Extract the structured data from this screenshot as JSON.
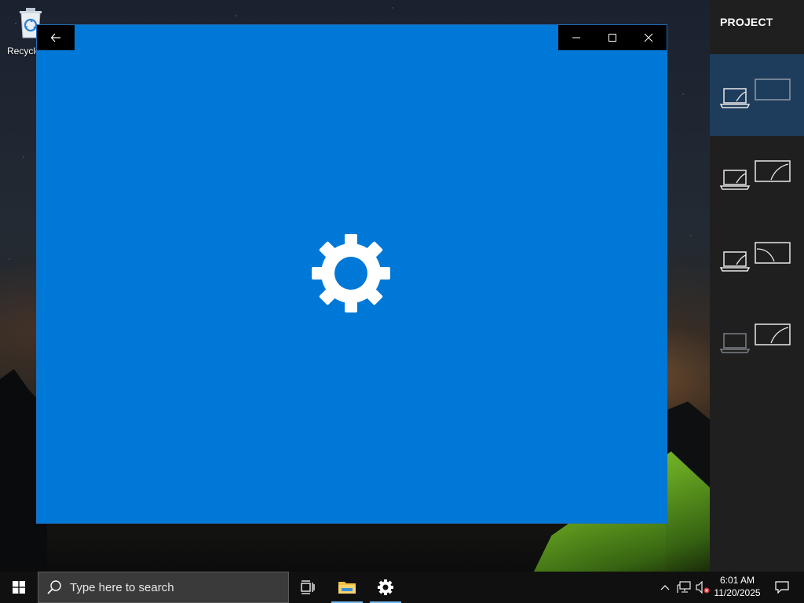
{
  "desktop": {
    "recycle_bin_label": "Recycle"
  },
  "app_window": {
    "background_color": "#0078d7",
    "back_icon": "back-arrow-icon",
    "center_icon": "gear-icon",
    "controls": [
      "minimize",
      "maximize",
      "close"
    ]
  },
  "project_pane": {
    "title": "PROJECT",
    "options": [
      {
        "mode": "pc-screen-only",
        "selected": true
      },
      {
        "mode": "duplicate",
        "selected": false
      },
      {
        "mode": "extend",
        "selected": false
      },
      {
        "mode": "second-screen-only",
        "selected": false
      }
    ],
    "accent_selected": "#1e3c5c"
  },
  "taskbar": {
    "search_placeholder": "Type here to search",
    "pinned": [
      "task-view",
      "file-explorer",
      "settings"
    ],
    "clock_time": "6:01 AM",
    "clock_date": "11/20/2025"
  }
}
